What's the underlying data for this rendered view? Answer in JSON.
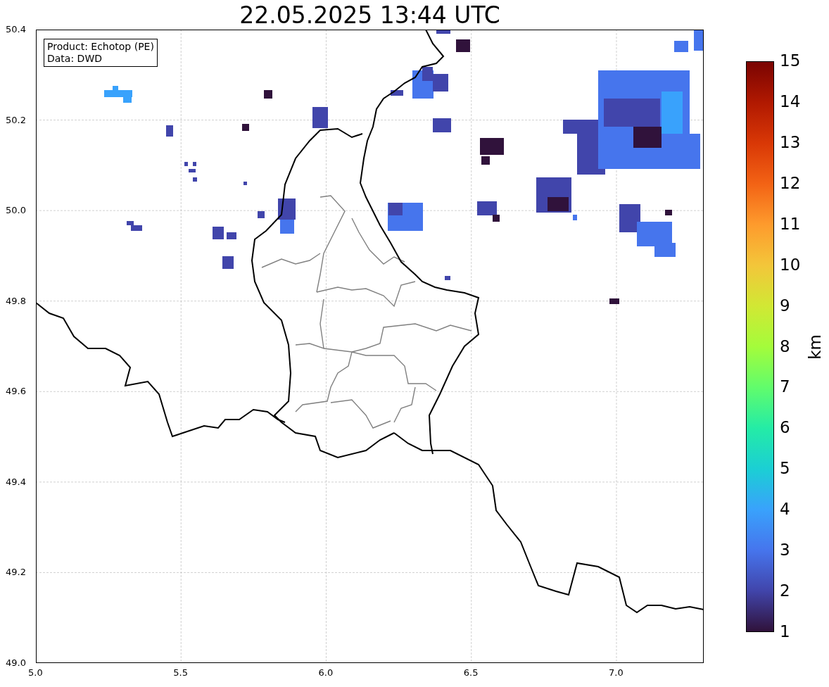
{
  "title": "22.05.2025 13:44 UTC",
  "info_box": {
    "lines": [
      "Product: Echotop (PE)",
      "Data: DWD"
    ]
  },
  "x_ticks": [
    "5.0",
    "5.5",
    "6.0",
    "6.5",
    "7.0"
  ],
  "y_ticks": [
    "50.4",
    "50.2",
    "50.0",
    "49.8",
    "49.6",
    "49.4",
    "49.2",
    "49.0"
  ],
  "colorbar": {
    "label": "km",
    "ticks": [
      "15",
      "14",
      "13",
      "12",
      "11",
      "10",
      "9",
      "8",
      "7",
      "6",
      "5",
      "4",
      "3",
      "2",
      "1"
    ]
  }
}
